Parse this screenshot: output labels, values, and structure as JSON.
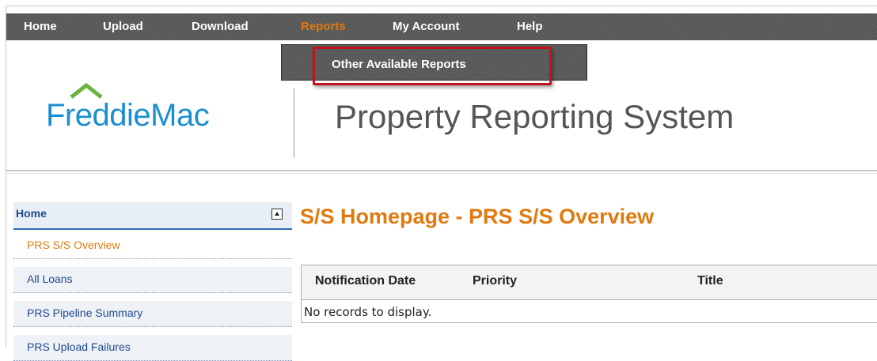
{
  "nav": {
    "items": [
      {
        "label": "Home"
      },
      {
        "label": "Upload"
      },
      {
        "label": "Download"
      },
      {
        "label": "Reports"
      },
      {
        "label": "My Account"
      },
      {
        "label": "Help"
      }
    ],
    "active": "Reports"
  },
  "dropdown": {
    "items": [
      {
        "label": "Other Available Reports"
      }
    ]
  },
  "header": {
    "logo_text": "FreddieMac",
    "system_title": "Property Reporting System"
  },
  "sidebar": {
    "title": "Home",
    "items": [
      {
        "label": "PRS S/S Overview",
        "active": true
      },
      {
        "label": "All Loans"
      },
      {
        "label": "PRS Pipeline Summary"
      },
      {
        "label": "PRS Upload Failures"
      }
    ]
  },
  "main": {
    "title": "S/S Homepage - PRS S/S Overview",
    "table": {
      "columns": [
        "Notification Date",
        "Priority",
        "Title"
      ],
      "empty_message": "No records to display."
    }
  },
  "colors": {
    "accent": "#e07a10",
    "brand_blue": "#1a8fd0",
    "nav_bg": "#5a5a5a",
    "highlight": "#c0141c"
  }
}
